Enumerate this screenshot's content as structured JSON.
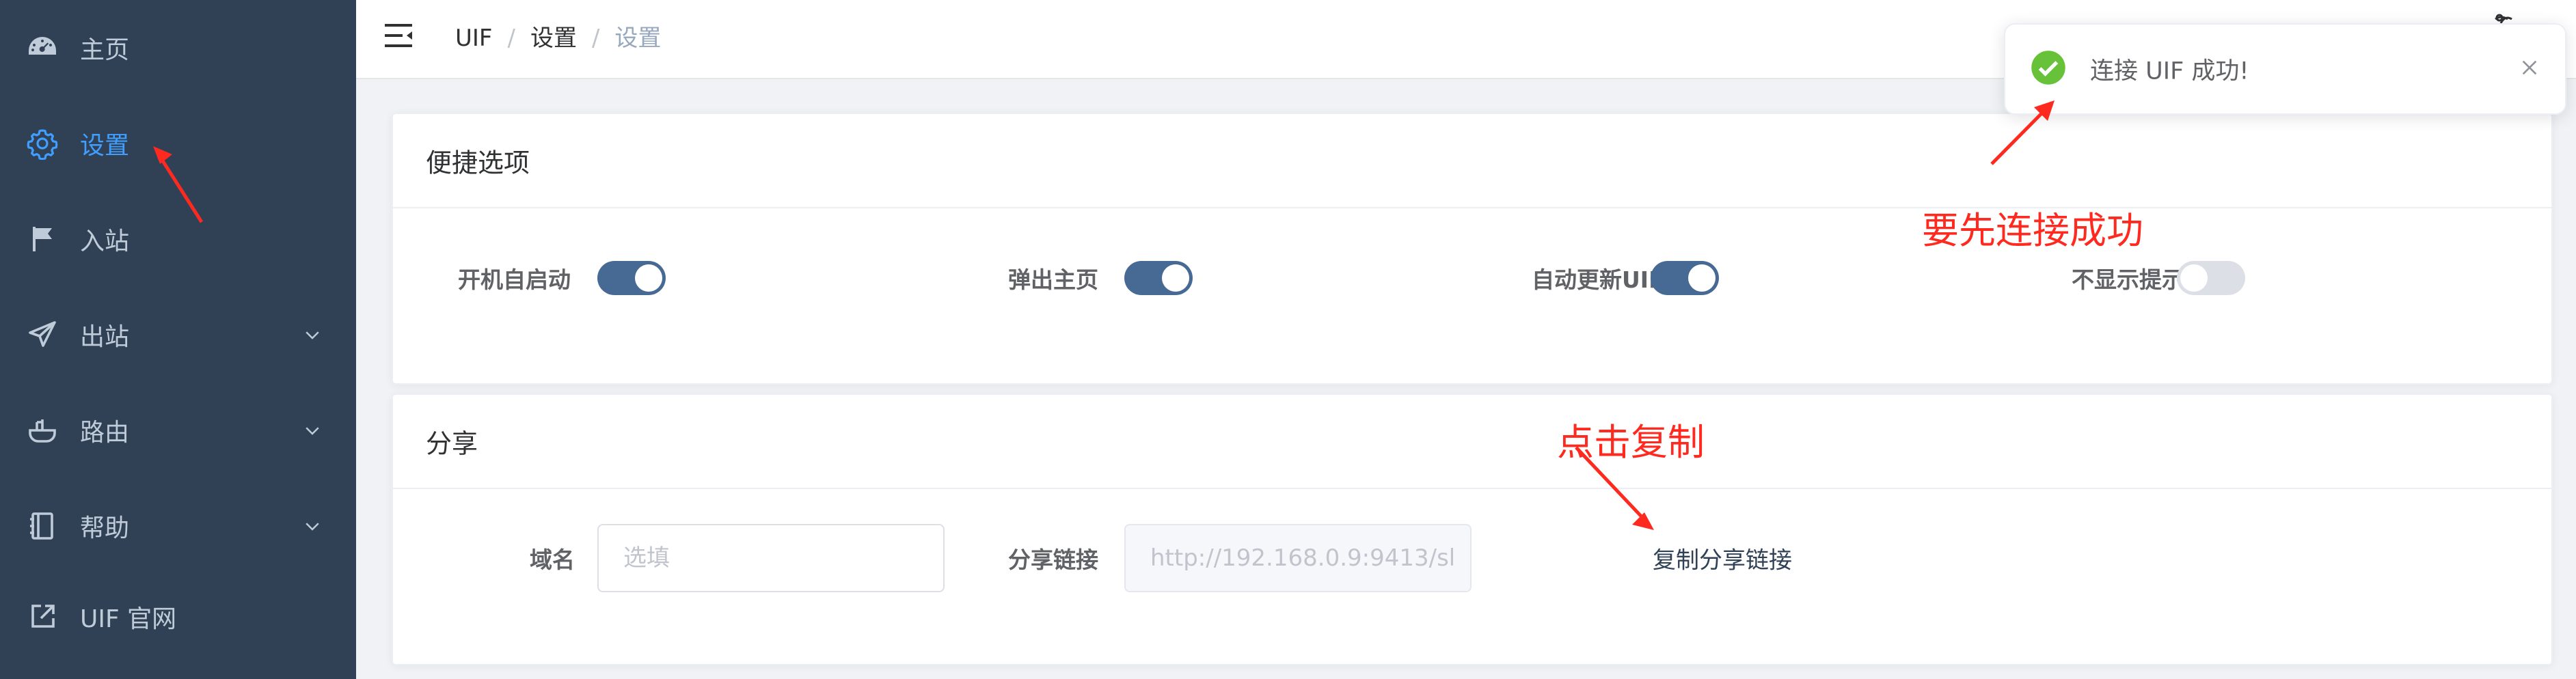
{
  "sidebar": {
    "items": [
      {
        "label": "主页",
        "icon": "dashboard-icon",
        "active": false
      },
      {
        "label": "设置",
        "icon": "gear-icon",
        "active": true
      },
      {
        "label": "入站",
        "icon": "flag-icon",
        "active": false
      },
      {
        "label": "出站",
        "icon": "send-icon",
        "active": false,
        "expandable": true
      },
      {
        "label": "路由",
        "icon": "route-icon",
        "active": false,
        "expandable": true
      },
      {
        "label": "帮助",
        "icon": "book-icon",
        "active": false,
        "expandable": true
      },
      {
        "label": "UIF 官网",
        "icon": "external-link-icon",
        "active": false
      }
    ],
    "bg_color": "#304156",
    "text_color": "#bfcbd9",
    "active_color": "#409eff"
  },
  "breadcrumb": [
    "UIF",
    "设置",
    "设置"
  ],
  "quick_options": {
    "title": "便捷选项",
    "items": [
      {
        "label": "开机自启动",
        "on": true
      },
      {
        "label": "弹出主页",
        "on": true
      },
      {
        "label": "自动更新UIF",
        "on": true
      },
      {
        "label": "不显示提示",
        "on": false
      }
    ]
  },
  "share": {
    "title": "分享",
    "domain_label": "域名",
    "domain_placeholder": "选填",
    "link_label": "分享链接",
    "link_value": "http://192.168.0.9:9413/sl",
    "copy_label": "复制分享链接"
  },
  "toast": {
    "message": "连接 UIF 成功!",
    "type": "success",
    "color": "#67c23a"
  },
  "annotations": {
    "connect_first": "要先连接成功",
    "click_copy": "点击复制",
    "color": "#ff2a1f"
  }
}
